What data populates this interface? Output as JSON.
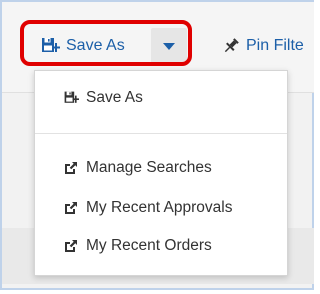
{
  "toolbar": {
    "save_as_label": "Save As",
    "pin_filter_label": "Pin Filte"
  },
  "menu": {
    "items": [
      {
        "label": "Save As",
        "icon": "save-as-icon"
      },
      {
        "label": "Manage Searches",
        "icon": "external-link-icon"
      },
      {
        "label": "My Recent Approvals",
        "icon": "external-link-icon"
      },
      {
        "label": "My Recent Orders",
        "icon": "external-link-icon"
      }
    ]
  },
  "colors": {
    "accent": "#1c5fa8",
    "highlight": "#e00000",
    "text": "#333333"
  }
}
